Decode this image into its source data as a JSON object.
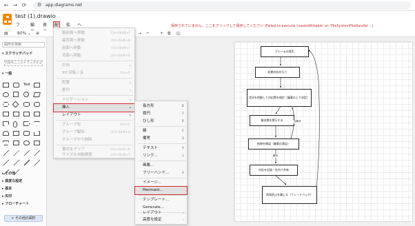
{
  "browser": {
    "url": "app.diagrams.net",
    "back": "←",
    "forward": "→",
    "reload": "⟳"
  },
  "app": {
    "title": "test (1).drawio"
  },
  "menubar": {
    "items": [
      "ファイル",
      "編集",
      "表示",
      "配置",
      "拡張",
      "ヘルプ"
    ]
  },
  "warning": "保存されていません。ここをクリックして保存してください (Failed to execute 'createWritable' on 'FileSystemFileHandle'...)",
  "toolbar": {
    "zoom": "80%",
    "connector": "→",
    "add": "+"
  },
  "leftpanel": {
    "search_placeholder": "図形を検索",
    "scratchpad": "スクラッチパッド",
    "dropzone": "内容をここにドラッグする",
    "general": "一般",
    "categories": [
      "その他",
      "高度な設定",
      "基本",
      "矢印",
      "フローチャート"
    ],
    "more_shapes": "+ その他の図形"
  },
  "arrange_menu": [
    {
      "label": "最前面へ移動",
      "shortcut": "Ctrl+Shift+F",
      "enabled": false
    },
    {
      "label": "最背面へ移動",
      "shortcut": "Ctrl+Shift+B",
      "enabled": false
    },
    {
      "label": "前面へ移動",
      "shortcut": "Ctrl+Shift+F",
      "enabled": false
    },
    {
      "label": "背面へ移動",
      "shortcut": "Ctrl+Shift+B",
      "enabled": false
    },
    {
      "label": "方向",
      "arrow": "›",
      "enabled": false
    },
    {
      "label": "90°回転 / 反",
      "shortcut": "Ctrl+R",
      "enabled": false
    },
    {
      "label": "配置",
      "arrow": "›",
      "enabled": false
    },
    {
      "label": "整列",
      "arrow": "›",
      "enabled": false
    },
    {
      "label": "ナビゲーション",
      "arrow": "›",
      "enabled": false
    },
    {
      "label": "挿入",
      "arrow": "›",
      "enabled": true,
      "highlight": true
    },
    {
      "label": "レイアウト",
      "arrow": "›",
      "enabled": true
    },
    {
      "label": "グループ化",
      "shortcut": "Ctrl+G",
      "enabled": false
    },
    {
      "label": "グループ解除",
      "shortcut": "Ctrl+Shift+U",
      "enabled": false
    },
    {
      "label": "グループから削除",
      "enabled": false
    },
    {
      "label": "書式をクリア",
      "shortcut": "Ctrl+Shift+R",
      "enabled": false
    },
    {
      "label": "サイズを自動調整",
      "shortcut": "Ctrl+Shift+Y",
      "enabled": false
    }
  ],
  "insert_menu": [
    {
      "label": "長方形",
      "shortcut": "D"
    },
    {
      "label": "楕円",
      "shortcut": "F"
    },
    {
      "label": "ひし形",
      "shortcut": "R"
    },
    {
      "label": "線",
      "shortcut": "C"
    },
    {
      "label": "備考",
      "shortcut": "S"
    },
    {
      "label": "テキスト",
      "shortcut": "A"
    },
    {
      "label": "リンク...",
      "shortcut": "L"
    },
    {
      "label": "画像..."
    },
    {
      "label": "フリーハンド...",
      "shortcut": "X"
    },
    {
      "label": "イメージ..."
    },
    {
      "label": "Mermaid...",
      "highlight": true
    },
    {
      "label": "テンプレート..."
    },
    {
      "label": "Generate..."
    },
    {
      "label": "レイアウト",
      "arrow": "›"
    },
    {
      "label": "高度な設定",
      "arrow": "›"
    }
  ],
  "diagram": {
    "nodes": [
      "クレームの発生",
      "初期対応を行う",
      "状況を把握して対応策を検討（議事の上で決定）",
      "解決策を実行する",
      "結果を確認（顧客の満足）",
      "対応を記録・社内で共有",
      "再発防止を講じる（フィードバック）"
    ],
    "edge_labels": [
      "未解決",
      "解決"
    ]
  }
}
